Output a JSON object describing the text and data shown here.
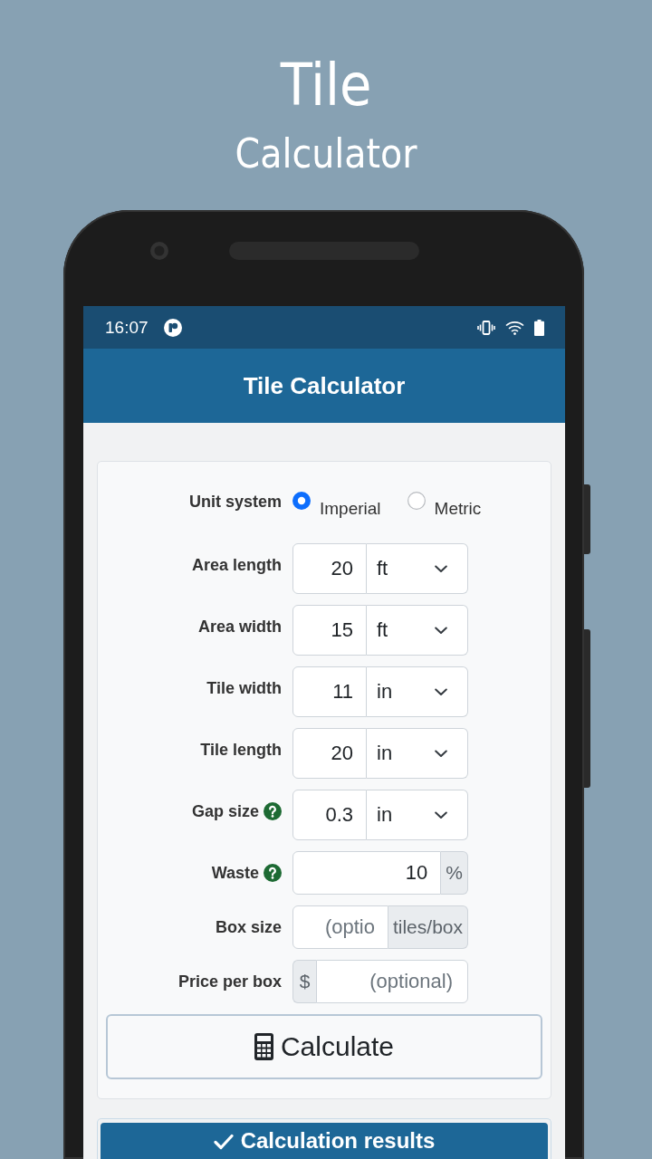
{
  "promo": {
    "title": "Tile",
    "subtitle": "Calculator"
  },
  "status_bar": {
    "time": "16:07"
  },
  "app_bar": {
    "title": "Tile Calculator"
  },
  "form": {
    "unit_system": {
      "label": "Unit system",
      "options": [
        {
          "label": "Imperial",
          "selected": true
        },
        {
          "label": "Metric",
          "selected": false
        }
      ]
    },
    "fields": [
      {
        "kind": "unit_select",
        "label": "Area length",
        "value": "20",
        "unit": "ft",
        "help": false
      },
      {
        "kind": "unit_select",
        "label": "Area width",
        "value": "15",
        "unit": "ft",
        "help": false
      },
      {
        "kind": "unit_select",
        "label": "Tile width",
        "value": "11",
        "unit": "in",
        "help": false
      },
      {
        "kind": "unit_select",
        "label": "Tile length",
        "value": "20",
        "unit": "in",
        "help": false
      },
      {
        "kind": "unit_select",
        "label": "Gap size",
        "value": "0.3",
        "unit": "in",
        "help": true
      },
      {
        "kind": "suffix",
        "label": "Waste",
        "value": "10",
        "addon": "%",
        "help": true
      },
      {
        "kind": "suffix",
        "label": "Box size",
        "placeholder": "(optio",
        "addon": "tiles/box",
        "help": false
      },
      {
        "kind": "prefix",
        "label": "Price per box",
        "placeholder": "(optional)",
        "addon": "$",
        "help": false
      }
    ],
    "calculate_button": {
      "label": "Calculate"
    }
  },
  "results_header": {
    "label": "Calculation results"
  }
}
